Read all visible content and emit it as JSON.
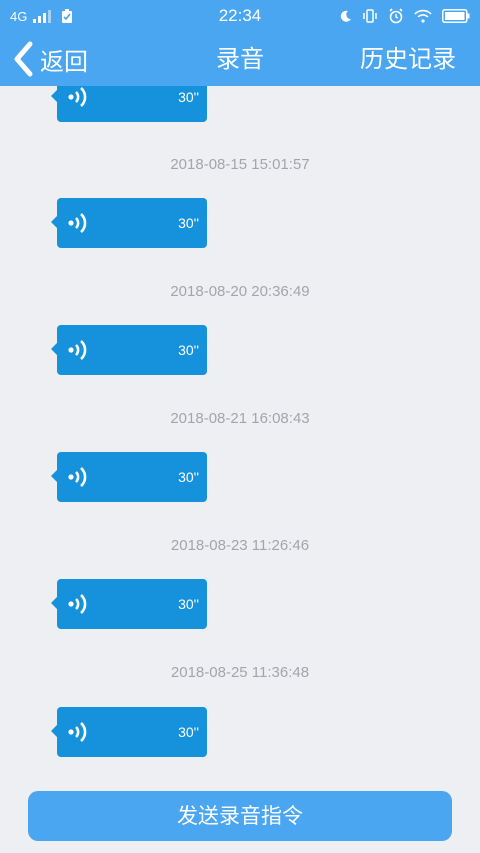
{
  "status_bar": {
    "network": "4G",
    "time": "22:34"
  },
  "nav": {
    "back_label": "返回",
    "title": "录音",
    "history_label": "历史记录"
  },
  "messages": [
    {
      "timestamp": "",
      "duration": "30''"
    },
    {
      "timestamp": "2018-08-15 15:01:57",
      "duration": "30''"
    },
    {
      "timestamp": "2018-08-20 20:36:49",
      "duration": "30''"
    },
    {
      "timestamp": "2018-08-21 16:08:43",
      "duration": "30''"
    },
    {
      "timestamp": "2018-08-23 11:26:46",
      "duration": "30''"
    },
    {
      "timestamp": "2018-08-25 11:36:48",
      "duration": "30''"
    }
  ],
  "send_button": {
    "label": "发送录音指令"
  },
  "colors": {
    "primary": "#4aa6f1",
    "bubble": "#1592db",
    "background": "#eeeff3",
    "timestamp_text": "#a3a5ab"
  },
  "icons": {
    "back": "chevron-left-icon",
    "voice": "sound-wave-icon"
  }
}
